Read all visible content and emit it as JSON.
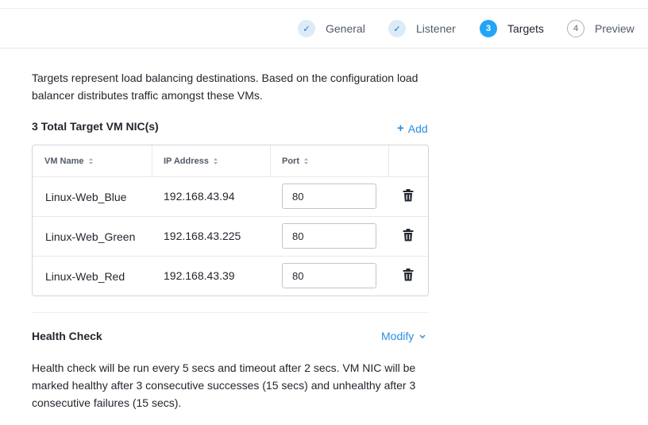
{
  "wizard": {
    "steps": [
      {
        "label": "General",
        "marker": "✓",
        "state": "done"
      },
      {
        "label": "Listener",
        "marker": "✓",
        "state": "done"
      },
      {
        "label": "Targets",
        "marker": "3",
        "state": "active"
      },
      {
        "label": "Preview",
        "marker": "4",
        "state": "pending"
      }
    ]
  },
  "intro": "Targets represent load balancing destinations. Based on the configuration load balancer distributes traffic amongst these VMs.",
  "targets": {
    "title": "3 Total Target VM NIC(s)",
    "add_label": "Add",
    "columns": [
      "VM Name",
      "IP Address",
      "Port"
    ],
    "rows": [
      {
        "vm_name": "Linux-Web_Blue",
        "ip": "192.168.43.94",
        "port": "80"
      },
      {
        "vm_name": "Linux-Web_Green",
        "ip": "192.168.43.225",
        "port": "80"
      },
      {
        "vm_name": "Linux-Web_Red",
        "ip": "192.168.43.39",
        "port": "80"
      }
    ]
  },
  "health_check": {
    "title": "Health Check",
    "modify_label": "Modify",
    "description": "Health check will be run every 5 secs and timeout after 2 secs. VM NIC will be marked healthy after 3 consecutive successes (15 secs) and unhealthy after 3 consecutive failures (15 secs)."
  },
  "colors": {
    "accent": "#22a5f7",
    "link": "#2a8fe0",
    "done_bg": "#dcebf8",
    "text": "#22272e",
    "muted": "#525a66",
    "border": "#d0d5da"
  },
  "icons": {
    "done_step": "check-icon",
    "sort": "sort-icon",
    "delete": "trash-icon",
    "add": "plus-icon",
    "expand": "chevron-down-icon"
  }
}
